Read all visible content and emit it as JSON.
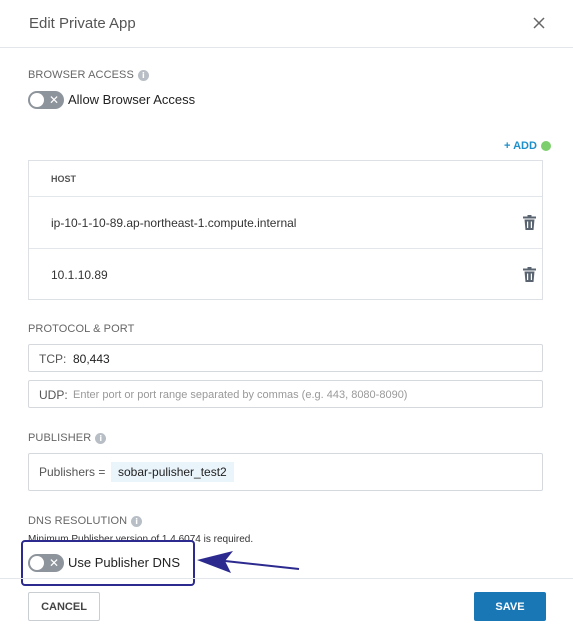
{
  "dialog": {
    "title": "Edit Private App"
  },
  "browser_access": {
    "label": "BROWSER ACCESS",
    "toggle_label": "Allow Browser Access",
    "enabled": false
  },
  "hosts": {
    "add_label": "+ ADD",
    "column_header": "HOST",
    "rows": [
      {
        "value": "ip-10-1-10-89.ap-northeast-1.compute.internal"
      },
      {
        "value": "10.1.10.89"
      }
    ]
  },
  "protocol_port": {
    "label": "PROTOCOL & PORT",
    "tcp": {
      "prefix": "TCP:",
      "value": "80,443"
    },
    "udp": {
      "prefix": "UDP:",
      "placeholder": "Enter port or port range separated by commas (e.g. 443, 8080-8090)"
    }
  },
  "publisher": {
    "label": "PUBLISHER",
    "prefix": "Publishers =",
    "selected": "sobar-pulisher_test2"
  },
  "dns_resolution": {
    "label": "DNS RESOLUTION",
    "note": "Minimum Publisher version of 1.4.6074 is required.",
    "toggle_label": "Use Publisher DNS",
    "enabled": false
  },
  "footer": {
    "cancel_label": "CANCEL",
    "save_label": "SAVE"
  },
  "colors": {
    "primary": "#1a77b5",
    "link": "#1e8fc9",
    "add_dot": "#7ccf6c",
    "toggle_off": "#8d949c",
    "annotation": "#2c2a8f"
  }
}
